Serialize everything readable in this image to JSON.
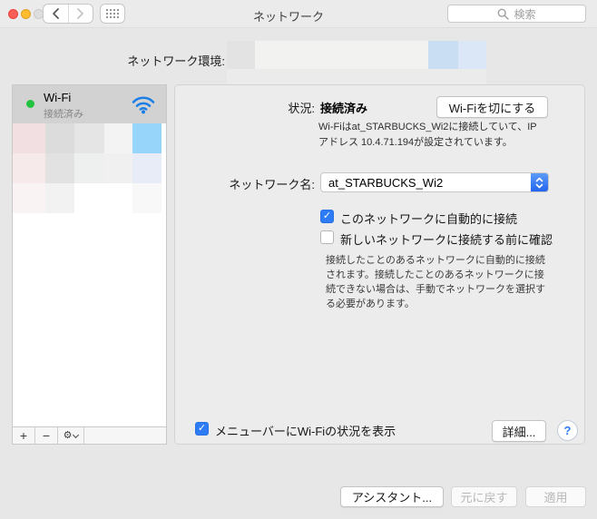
{
  "titlebar": {
    "title": "ネットワーク",
    "search_placeholder": "検索"
  },
  "location": {
    "label": "ネットワーク環境:",
    "redacted_segments": [
      "#e3e3e3",
      "#f2f2f1",
      "#cadef3",
      "#dbe7f6"
    ],
    "redacted_lower_color": "#ebebeb"
  },
  "sidebar": {
    "wifi_name": "Wi-Fi",
    "wifi_status": "接続済み",
    "redacted_rows": [
      [
        "#f1dfe1",
        "#dcdcdc",
        "#e5e5e5",
        "#f3f3f3",
        "#98d5fa"
      ],
      [
        "#f6eaeb",
        "#e2e2e2",
        "#eeefef",
        "#f0f0f0",
        "#e7ecf7"
      ],
      [
        "#faf3f3",
        "#f2f2f3",
        "#ffffff",
        "#ffffff",
        "#f8f8f8"
      ]
    ],
    "toolbar": {
      "add": "+",
      "remove": "−"
    }
  },
  "main": {
    "status_label": "状況:",
    "status_value": "接続済み",
    "turn_off_wifi_button": "Wi-Fiを切にする",
    "status_description": "Wi-Fiはat_STARBUCKS_Wi2に接続していて、IPアドレス 10.4.71.194が設定されています。",
    "network_name_label": "ネットワーク名:",
    "network_name_value": "at_STARBUCKS_Wi2",
    "auto_join_checkbox": {
      "label": "このネットワークに自動的に接続",
      "checked": true
    },
    "ask_before_join_checkbox": {
      "label": "新しいネットワークに接続する前に確認",
      "checked": false
    },
    "help_text": "接続したことのあるネットワークに自動的に接続されます。接続したことのあるネットワークに接続できない場合は、手動でネットワークを選択する必要があります。",
    "menubar_checkbox": {
      "label": "メニューバーにWi-Fiの状況を表示",
      "checked": true
    },
    "advanced_button": "詳細...",
    "help_button": "?"
  },
  "footer": {
    "assistant_button": "アシスタント...",
    "revert_button": "元に戻す",
    "apply_button": "適用"
  },
  "icons": {
    "checkmark": "✓",
    "gear": "⚙"
  },
  "colors": {
    "accent_blue": "#2e7cf5",
    "wifi_icon_blue": "#1a7ee6",
    "status_green": "#23c340",
    "traffic_red": "#ff5f57",
    "traffic_yellow": "#febc2e"
  }
}
